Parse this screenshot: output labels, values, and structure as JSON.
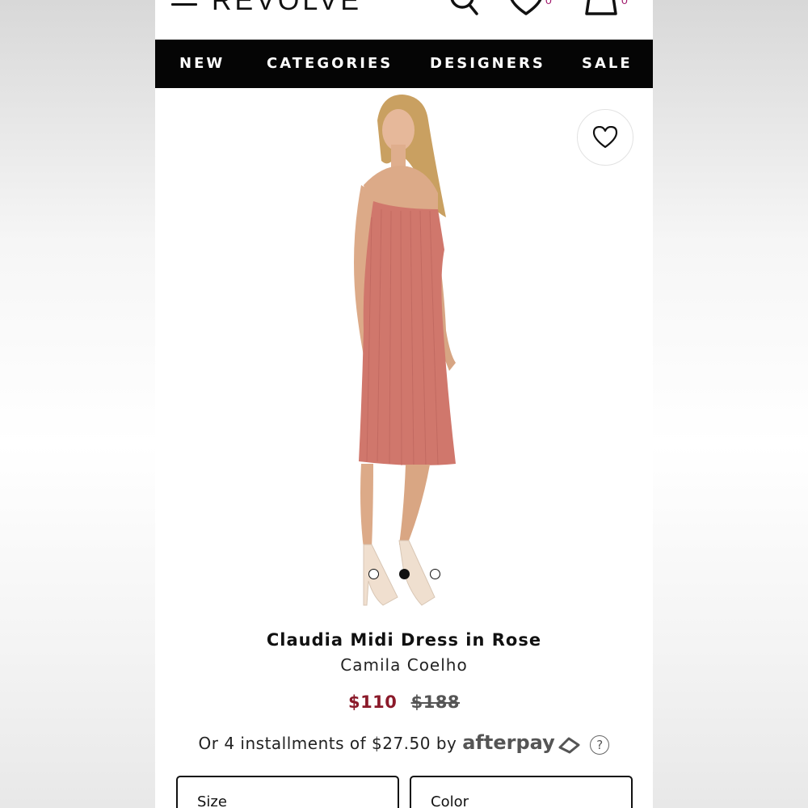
{
  "header": {
    "logo": "REVOLVE",
    "wishlist_count": "0",
    "bag_count": "0"
  },
  "nav": {
    "items": [
      {
        "label": "NEW"
      },
      {
        "label": "CATEGORIES"
      },
      {
        "label": "DESIGNERS"
      },
      {
        "label": "SALE"
      }
    ]
  },
  "carousel": {
    "count": 3,
    "active_index": 1
  },
  "product": {
    "name": "Claudia Midi Dress in Rose",
    "designer": "Camila Coelho",
    "sale_price": "$110",
    "original_price": "$188",
    "installments_text": "Or 4 installments of $27.50 by",
    "installments_provider": "afterpay",
    "help_symbol": "?"
  },
  "selectors": {
    "size_label": "Size",
    "color_label": "Color"
  },
  "colors": {
    "accent_sale": "#8b1a2a",
    "badge": "#a0186b",
    "nav_bg": "#050505"
  }
}
